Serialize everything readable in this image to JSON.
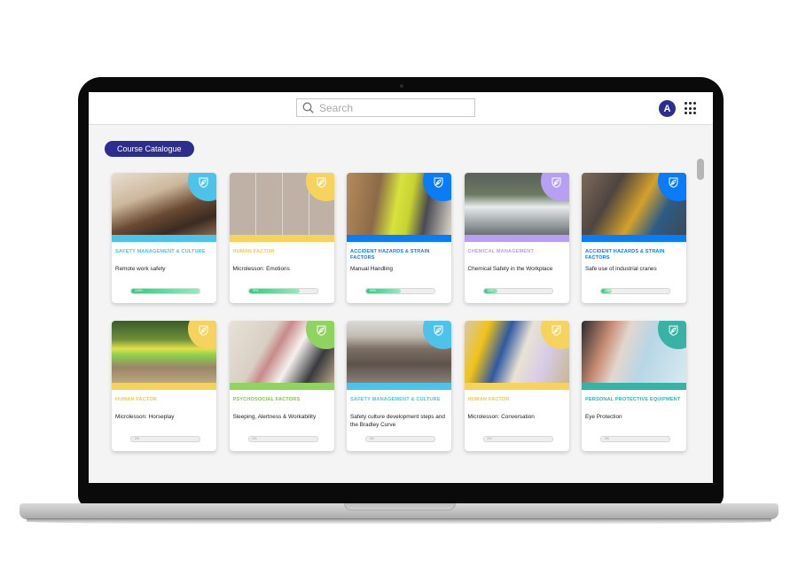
{
  "header": {
    "search_placeholder": "Search",
    "avatar_initial": "A",
    "apps_menu": "grid-dots-icon"
  },
  "page": {
    "badge_label": "Course Catalogue"
  },
  "colors": {
    "brand": "#2d2d8f",
    "safety_culture": "#4dc3ea",
    "human_factor": "#f5d35c",
    "accident_hazards": "#0a7cf5",
    "chemical": "#b79ff2",
    "psychosocial": "#8ed45e",
    "ppe": "#37b2a5",
    "progress": "#3cc67e"
  },
  "courses": [
    {
      "category": "Safety Management & Culture",
      "title": "Remote work safety",
      "progress": 100,
      "progress_label": "100%",
      "color": "#4dc3ea",
      "cat_color": "#4dc3ea",
      "thumb": "home-office-photo"
    },
    {
      "category": "Human Factor",
      "title": "Microlesson: Emotions",
      "progress": 75,
      "progress_label": "75%",
      "color": "#f5d35c",
      "cat_color": "#f2c94c",
      "thumb": "emotions-faces-photo"
    },
    {
      "category": "Accident Hazards & Strain Factors",
      "title": "Manual Handling",
      "progress": 50,
      "progress_label": "50%",
      "color": "#0a7cf5",
      "cat_color": "#0a7cf5",
      "thumb": "warehouse-pallet-photo"
    },
    {
      "category": "Chemical Management",
      "title": "Chemical Safety in the Workplace",
      "progress": 20,
      "progress_label": "20%",
      "color": "#b79ff2",
      "cat_color": "#b79ff2",
      "thumb": "hazmat-suits-photo"
    },
    {
      "category": "Accident Hazards & Strain Factors",
      "title": "Safe use of industrial cranes",
      "progress": 15,
      "progress_label": "15%",
      "color": "#0a7cf5",
      "cat_color": "#0a7cf5",
      "thumb": "crane-remote-photo"
    },
    {
      "category": "Human Factor",
      "title": "Microlesson: Horseplay",
      "progress": 0,
      "progress_label": "0%",
      "color": "#f5d35c",
      "cat_color": "#f2c94c",
      "thumb": "sack-race-photo"
    },
    {
      "category": "Psychosocial Factors",
      "title": "Sleeping, Alertness & Workability",
      "progress": 0,
      "progress_label": "0%",
      "color": "#8ed45e",
      "cat_color": "#7cc94a",
      "thumb": "tired-parent-photo"
    },
    {
      "category": "Safety Management & Culture",
      "title": "Safety culture development steps and the Bradley Curve",
      "progress": 0,
      "progress_label": "0%",
      "color": "#4dc3ea",
      "cat_color": "#4dc3ea",
      "thumb": "pyramid-photo"
    },
    {
      "category": "Human Factor",
      "title": "Microlesson: Conversation",
      "progress": 0,
      "progress_label": "0%",
      "color": "#f5d35c",
      "cat_color": "#f2c94c",
      "thumb": "warehouse-conversation-photo"
    },
    {
      "category": "Personal Protective Equipment",
      "title": "Eye Protection",
      "progress": 0,
      "progress_label": "0%",
      "color": "#37b2a5",
      "cat_color": "#37b2a5",
      "thumb": "safety-glasses-photo"
    }
  ]
}
